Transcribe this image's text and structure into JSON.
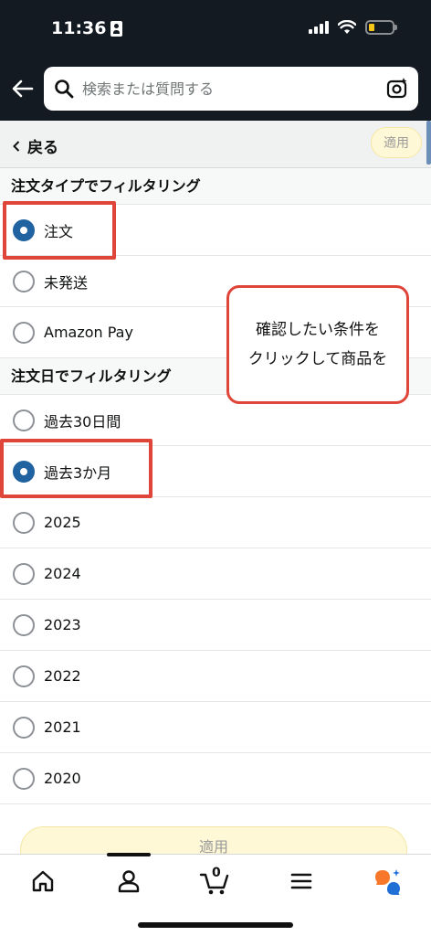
{
  "status_bar": {
    "time": "11:36"
  },
  "header": {
    "search_placeholder": "検索または質問する"
  },
  "nav": {
    "back_label": "戻る",
    "apply_label": "適用"
  },
  "sections": [
    {
      "title": "注文タイプでフィルタリング",
      "options": [
        {
          "label": "注文",
          "checked": true
        },
        {
          "label": "未発送",
          "checked": false
        },
        {
          "label": "Amazon Pay",
          "checked": false
        }
      ]
    },
    {
      "title": "注文日でフィルタリング",
      "options": [
        {
          "label": "過去30日間",
          "checked": false
        },
        {
          "label": "過去3か月",
          "checked": true
        },
        {
          "label": "2025",
          "checked": false
        },
        {
          "label": "2024",
          "checked": false
        },
        {
          "label": "2023",
          "checked": false
        },
        {
          "label": "2022",
          "checked": false
        },
        {
          "label": "2021",
          "checked": false
        },
        {
          "label": "2020",
          "checked": false
        }
      ]
    }
  ],
  "callout": {
    "line1": "確認したい条件を",
    "line2": "クリックして商品を"
  },
  "footer": {
    "apply_label": "適用",
    "cart_count": "0"
  },
  "colors": {
    "header_bg": "#131a22",
    "radio_selected": "#2162a1",
    "annotation_red": "#e0453a",
    "apply_bg": "#fff8d6",
    "assistant_orange": "#f7772b",
    "assistant_blue": "#1f6fd6"
  }
}
